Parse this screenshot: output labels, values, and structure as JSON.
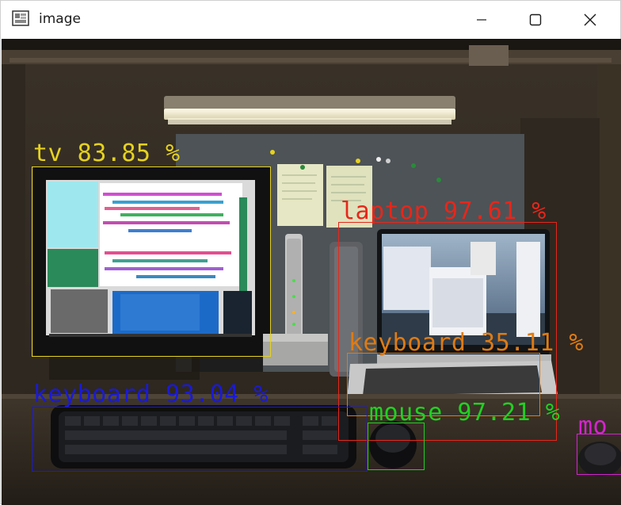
{
  "window": {
    "title": "image",
    "controls": {
      "minimize": "minimize",
      "maximize": "maximize",
      "close": "close"
    }
  },
  "detections": [
    {
      "name": "tv",
      "label": "tv 83.85 %",
      "color": "#e6d21e"
    },
    {
      "name": "laptop",
      "label": "laptop 97.61 %",
      "color": "#e8261a"
    },
    {
      "name": "keyboard-laptop",
      "label": "keyboard 35.11 %",
      "color": "#e07b12"
    },
    {
      "name": "keyboard-desk",
      "label": "keyboard 93.04 %",
      "color": "#1a1ad6"
    },
    {
      "name": "mouse",
      "label": "mouse 97.21 %",
      "color": "#22d022"
    },
    {
      "name": "mouse-edge",
      "label": "mo",
      "color": "#d623d0"
    }
  ]
}
